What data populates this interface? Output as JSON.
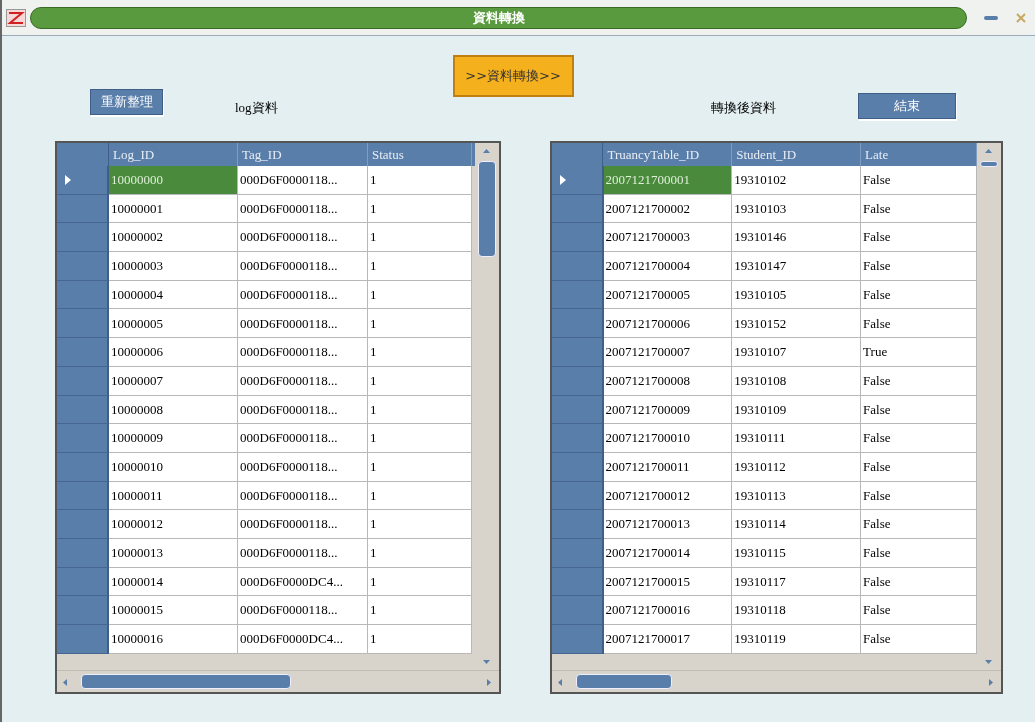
{
  "window": {
    "title": "資料轉換"
  },
  "toolbar": {
    "reorganize_button": "重新整理",
    "left_label": "log資料",
    "convert_button": ">>資料轉換>>",
    "right_label": "轉換後資料",
    "close_button": "結束"
  },
  "left_table": {
    "columns": [
      "Log_ID",
      "Tag_ID",
      "Status"
    ],
    "rows": [
      {
        "selected": true,
        "cells": [
          "10000000",
          "000D6F0000118...",
          "1"
        ]
      },
      {
        "selected": false,
        "cells": [
          "10000001",
          "000D6F0000118...",
          "1"
        ]
      },
      {
        "selected": false,
        "cells": [
          "10000002",
          "000D6F0000118...",
          "1"
        ]
      },
      {
        "selected": false,
        "cells": [
          "10000003",
          "000D6F0000118...",
          "1"
        ]
      },
      {
        "selected": false,
        "cells": [
          "10000004",
          "000D6F0000118...",
          "1"
        ]
      },
      {
        "selected": false,
        "cells": [
          "10000005",
          "000D6F0000118...",
          "1"
        ]
      },
      {
        "selected": false,
        "cells": [
          "10000006",
          "000D6F0000118...",
          "1"
        ]
      },
      {
        "selected": false,
        "cells": [
          "10000007",
          "000D6F0000118...",
          "1"
        ]
      },
      {
        "selected": false,
        "cells": [
          "10000008",
          "000D6F0000118...",
          "1"
        ]
      },
      {
        "selected": false,
        "cells": [
          "10000009",
          "000D6F0000118...",
          "1"
        ]
      },
      {
        "selected": false,
        "cells": [
          "10000010",
          "000D6F0000118...",
          "1"
        ]
      },
      {
        "selected": false,
        "cells": [
          "10000011",
          "000D6F0000118...",
          "1"
        ]
      },
      {
        "selected": false,
        "cells": [
          "10000012",
          "000D6F0000118...",
          "1"
        ]
      },
      {
        "selected": false,
        "cells": [
          "10000013",
          "000D6F0000118...",
          "1"
        ]
      },
      {
        "selected": false,
        "cells": [
          "10000014",
          "000D6F0000DC4...",
          "1"
        ]
      },
      {
        "selected": false,
        "cells": [
          "10000015",
          "000D6F0000118...",
          "1"
        ]
      },
      {
        "selected": false,
        "cells": [
          "10000016",
          "000D6F0000DC4...",
          "1"
        ]
      }
    ]
  },
  "right_table": {
    "columns": [
      "TruancyTable_ID",
      "Student_ID",
      "Late"
    ],
    "rows": [
      {
        "selected": true,
        "cells": [
          "2007121700001",
          "19310102",
          "False"
        ]
      },
      {
        "selected": false,
        "cells": [
          "2007121700002",
          "19310103",
          "False"
        ]
      },
      {
        "selected": false,
        "cells": [
          "2007121700003",
          "19310146",
          "False"
        ]
      },
      {
        "selected": false,
        "cells": [
          "2007121700004",
          "19310147",
          "False"
        ]
      },
      {
        "selected": false,
        "cells": [
          "2007121700005",
          "19310105",
          "False"
        ]
      },
      {
        "selected": false,
        "cells": [
          "2007121700006",
          "19310152",
          "False"
        ]
      },
      {
        "selected": false,
        "cells": [
          "2007121700007",
          "19310107",
          "True"
        ]
      },
      {
        "selected": false,
        "cells": [
          "2007121700008",
          "19310108",
          "False"
        ]
      },
      {
        "selected": false,
        "cells": [
          "2007121700009",
          "19310109",
          "False"
        ]
      },
      {
        "selected": false,
        "cells": [
          "2007121700010",
          "19310111",
          "False"
        ]
      },
      {
        "selected": false,
        "cells": [
          "2007121700011",
          "19310112",
          "False"
        ]
      },
      {
        "selected": false,
        "cells": [
          "2007121700012",
          "19310113",
          "False"
        ]
      },
      {
        "selected": false,
        "cells": [
          "2007121700013",
          "19310114",
          "False"
        ]
      },
      {
        "selected": false,
        "cells": [
          "2007121700014",
          "19310115",
          "False"
        ]
      },
      {
        "selected": false,
        "cells": [
          "2007121700015",
          "19310117",
          "False"
        ]
      },
      {
        "selected": false,
        "cells": [
          "2007121700016",
          "19310118",
          "False"
        ]
      },
      {
        "selected": false,
        "cells": [
          "2007121700017",
          "19310119",
          "False"
        ]
      }
    ]
  }
}
